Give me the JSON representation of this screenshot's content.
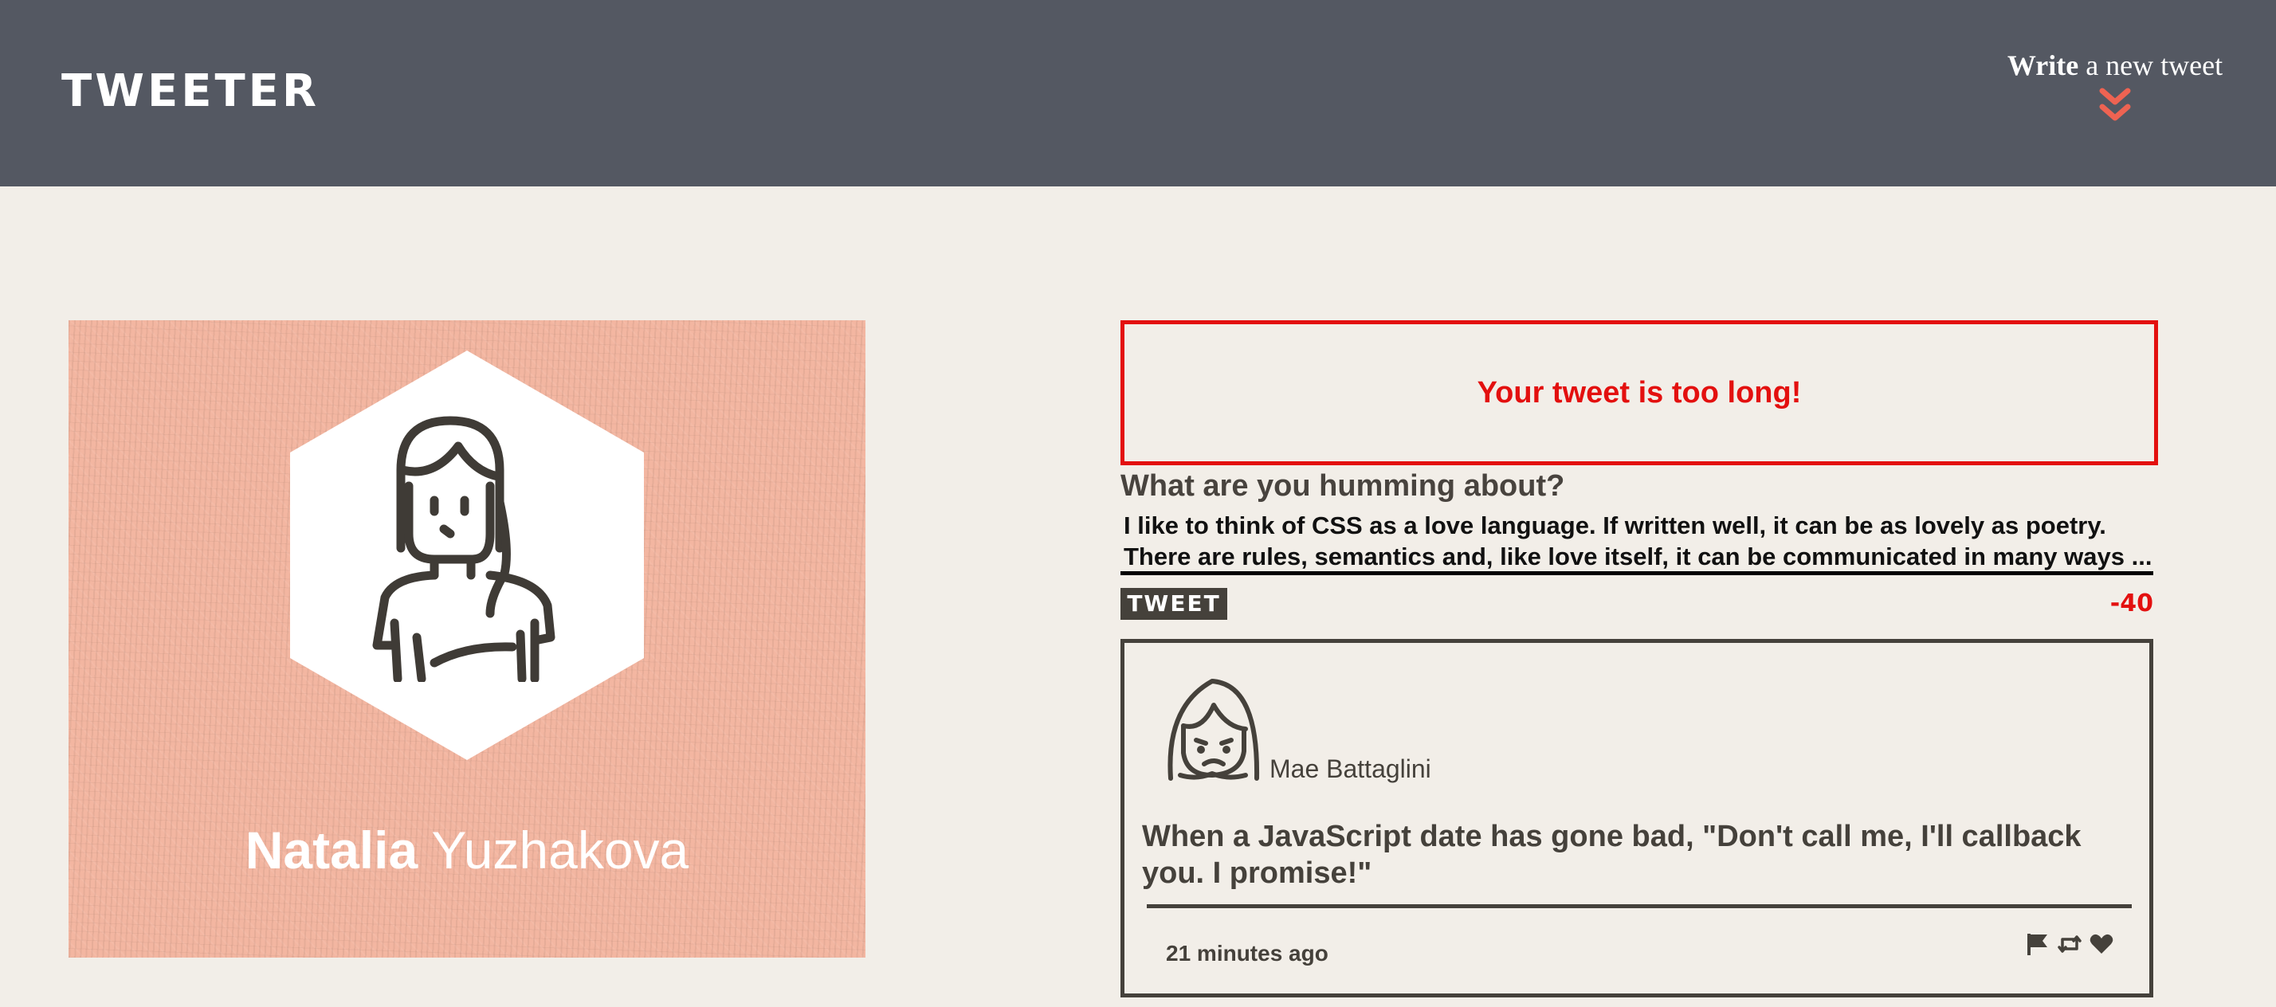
{
  "nav": {
    "brand": "TWEETER",
    "write_bold": "Write",
    "write_rest": " a new tweet",
    "toggle_icon": "double-chevron-down-icon"
  },
  "profile": {
    "first_name": "Natalia",
    "last_name": "Yuzhakova",
    "avatar_icon": "woman-avatar-icon"
  },
  "compose": {
    "error": "Your tweet is too long!",
    "label": "What are you humming about?",
    "text": "I like to think of CSS as a love language. If written well, it can be as lovely as poetry. There are rules, semantics and, like love itself, it can be communicated in many ways ...",
    "button": "TWEET",
    "counter": "-40"
  },
  "tweets": [
    {
      "author": "Mae Battaglini",
      "avatar_icon": "sad-woman-avatar-icon",
      "content": "When a JavaScript date has gone bad, \"Don't call me, I'll callback you. I promise!\"",
      "time": "21 minutes ago",
      "actions": [
        "flag-icon",
        "retweet-icon",
        "heart-icon"
      ]
    }
  ],
  "colors": {
    "nav_bg": "#545862",
    "page_bg": "#f2eee8",
    "accent": "#ee6352",
    "error": "#e3100f",
    "profile_bg": "#f3b6a1",
    "text_dark": "#45413b"
  }
}
